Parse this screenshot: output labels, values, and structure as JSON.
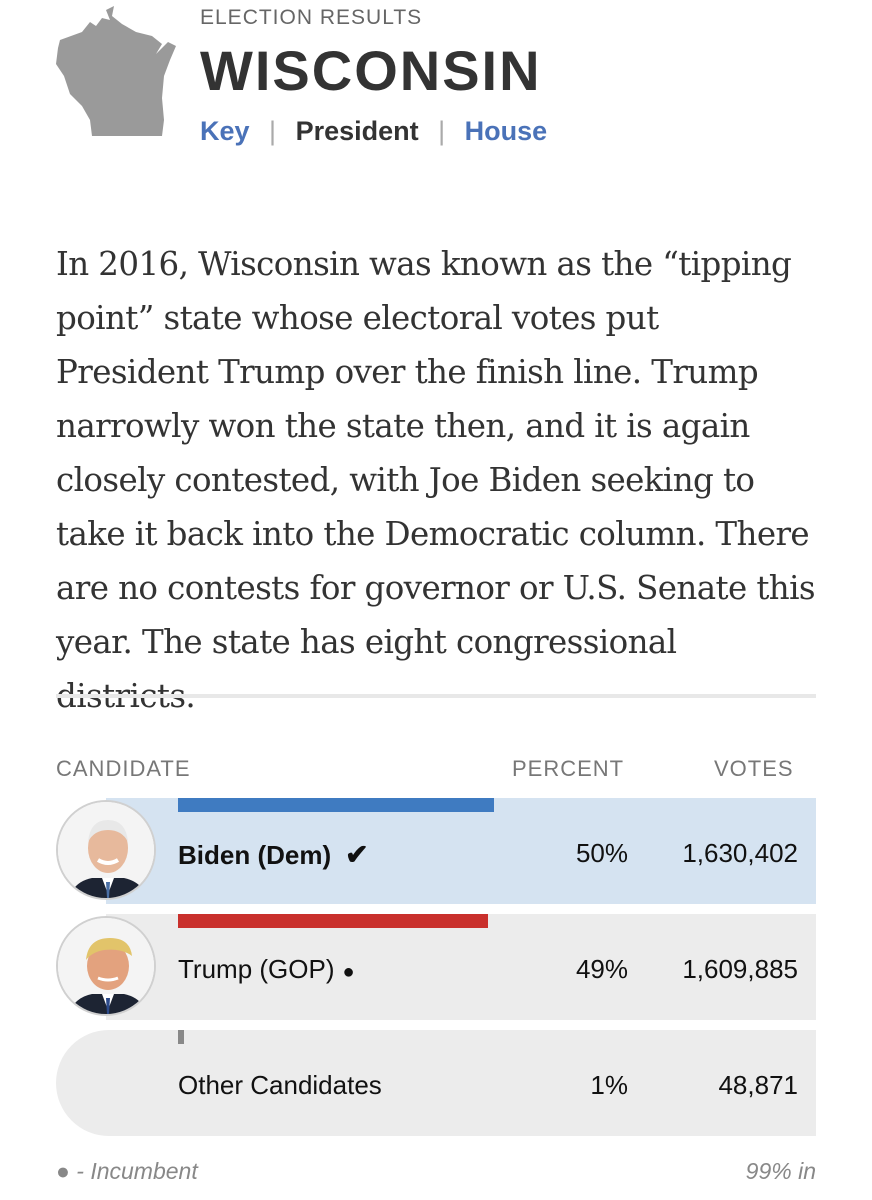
{
  "header": {
    "kicker": "ELECTION RESULTS",
    "title": "WISCONSIN",
    "nav": [
      {
        "label": "Key",
        "active": false
      },
      {
        "label": "President",
        "active": true
      },
      {
        "label": "House",
        "active": false
      }
    ],
    "separator": "|"
  },
  "intro": "In 2016, Wisconsin was known as the “tipping point” state whose electoral votes put President Trump over the finish line. Trump narrowly won the state then, and it is again closely contested, with Joe Biden seeking to take it back into the Democratic column. There are no contests for governor or U.S. Senate this year. The state has eight congressional districts.",
  "table": {
    "headers": {
      "candidate": "CANDIDATE",
      "percent": "PERCENT",
      "votes": "VOTES"
    },
    "rows": [
      {
        "name": "Biden (Dem)",
        "marker": "✔",
        "percent": "50%",
        "percent_value": 50,
        "votes": "1,630,402",
        "color": "#3f7bc1"
      },
      {
        "name": "Trump (GOP)",
        "marker": "●",
        "percent": "49%",
        "percent_value": 49,
        "votes": "1,609,885",
        "color": "#c9302c"
      },
      {
        "name": "Other Candidates",
        "marker": "",
        "percent": "1%",
        "percent_value": 1,
        "votes": "48,871",
        "color": "#888888"
      }
    ]
  },
  "footer": {
    "legend": "● - Incumbent",
    "reporting": "99% in"
  },
  "colors": {
    "link": "#4a72b8",
    "winner_row": "#d5e3f1",
    "row": "#ececec",
    "dem": "#3f7bc1",
    "gop": "#c9302c",
    "map": "#9a9a9a"
  }
}
